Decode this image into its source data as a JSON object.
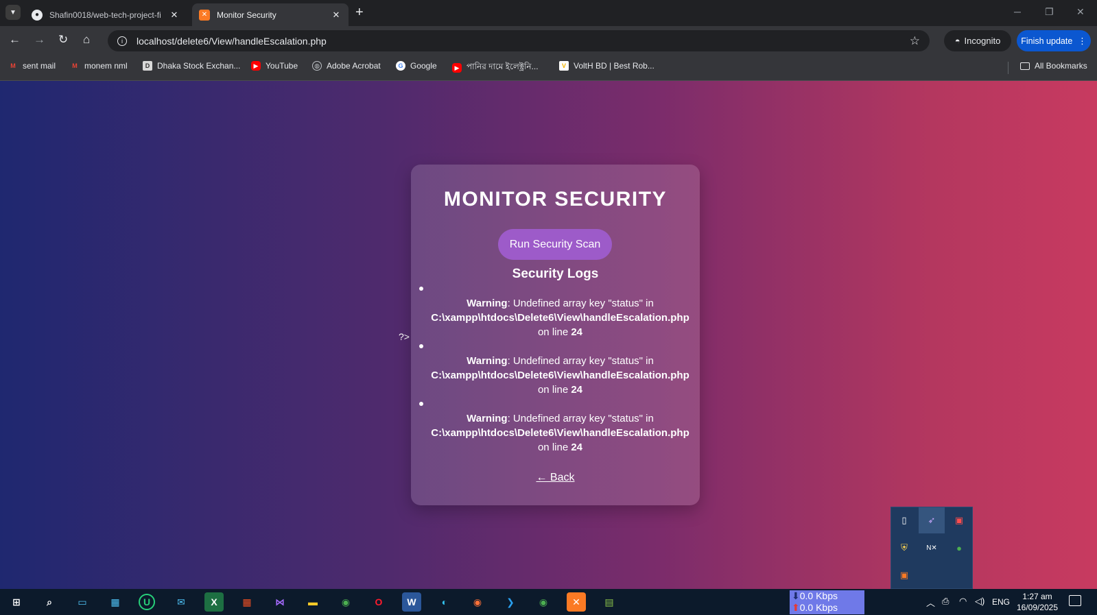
{
  "browser": {
    "tabs": [
      {
        "title": "Shafin0018/web-tech-project-fi",
        "favicon": "github-icon",
        "active": false
      },
      {
        "title": "Monitor Security",
        "favicon": "xampp-icon",
        "active": true
      }
    ],
    "url": "localhost/delete6/View/handleEscalation.php",
    "incognito_label": "Incognito",
    "finish_update_label": "Finish update",
    "bookmarks": [
      {
        "label": "sent mail",
        "icon": "gmail-icon"
      },
      {
        "label": "monem nml",
        "icon": "gmail-icon"
      },
      {
        "label": "Dhaka Stock Exchan...",
        "icon": "dse-icon"
      },
      {
        "label": "YouTube",
        "icon": "youtube-icon"
      },
      {
        "label": "Adobe Acrobat",
        "icon": "globe-icon"
      },
      {
        "label": "Google",
        "icon": "google-icon"
      },
      {
        "label": "পানির দামে ইলেক্ট্রনি...",
        "icon": "youtube-icon"
      },
      {
        "label": "VoltH BD | Best Rob...",
        "icon": "volth-icon"
      }
    ],
    "all_bookmarks_label": "All Bookmarks"
  },
  "page": {
    "title": "MONITOR SECURITY",
    "scan_button": "Run Security Scan",
    "logs_heading": "Security Logs",
    "stray_text": "?>",
    "logs": [
      {
        "warning": "Warning",
        "text": ": Undefined array key \"status\" in",
        "path": "C:\\xampp\\htdocs\\Delete6\\View\\handleEscalation.php",
        "line_prefix": "on line",
        "line": "24"
      },
      {
        "warning": "Warning",
        "text": ": Undefined array key \"status\" in",
        "path": "C:\\xampp\\htdocs\\Delete6\\View\\handleEscalation.php",
        "line_prefix": "on line",
        "line": "24"
      },
      {
        "warning": "Warning",
        "text": ": Undefined array key \"status\" in",
        "path": "C:\\xampp\\htdocs\\Delete6\\View\\handleEscalation.php",
        "line_prefix": "on line",
        "line": "24"
      }
    ],
    "back_link": "← Back"
  },
  "taskbar": {
    "net_down": "0.0 Kbps",
    "net_up": "0.0 Kbps",
    "language": "ENG",
    "time": "1:27 am",
    "date": "16/09/2025"
  },
  "colors": {
    "scan_button": "#9d5bc9",
    "gradient_left": "#1f2870",
    "gradient_right": "#c83a60",
    "update_button": "#0b57d0"
  }
}
